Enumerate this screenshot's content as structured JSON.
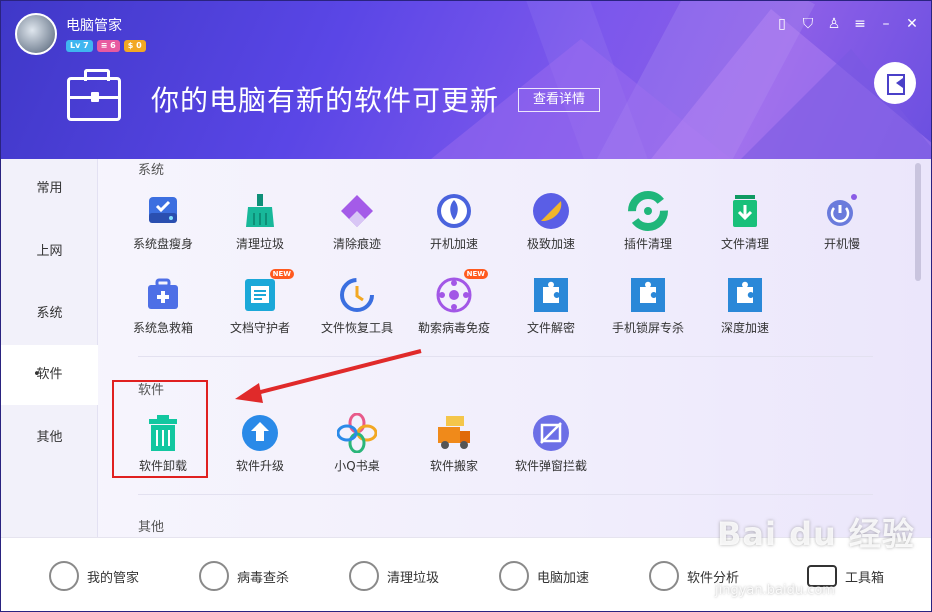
{
  "app": {
    "name": "电脑管家",
    "badges": [
      "Lv 7",
      "≡ 6",
      "$ 0"
    ]
  },
  "window_controls": [
    "phone-icon",
    "shield-icon",
    "shirt-icon",
    "menu-icon",
    "minimize-icon",
    "close-icon"
  ],
  "hero": {
    "title": "你的电脑有新的软件可更新",
    "button": "查看详情"
  },
  "sidebar": {
    "items": [
      {
        "label": "常用"
      },
      {
        "label": "上网"
      },
      {
        "label": "系统"
      },
      {
        "label": "软件",
        "active": true
      },
      {
        "label": "其他"
      }
    ]
  },
  "sections": {
    "system_title": "系统",
    "software_title": "软件",
    "other_title": "其他"
  },
  "system_tools": [
    {
      "label": "系统盘瘦身",
      "icon": "disk-icon",
      "color": "#3c6fe0"
    },
    {
      "label": "清理垃圾",
      "icon": "broom-icon",
      "color": "#18b89a"
    },
    {
      "label": "清除痕迹",
      "icon": "eraser-icon",
      "color": "#a45be8"
    },
    {
      "label": "开机加速",
      "icon": "rocket-icon",
      "color": "#4a63dd"
    },
    {
      "label": "极致加速",
      "icon": "feather-icon",
      "color": "#5a5ee6"
    },
    {
      "label": "插件清理",
      "icon": "puzzle-green-icon",
      "color": "#1fb67a"
    },
    {
      "label": "文件清理",
      "icon": "bin-download-icon",
      "color": "#18c07a"
    },
    {
      "label": "开机慢",
      "icon": "power-icon",
      "color": "#6a7bdc"
    },
    {
      "label": "系统急救箱",
      "icon": "firstaid-icon",
      "color": "#4e6fe6"
    },
    {
      "label": "文档守护者",
      "icon": "document-icon",
      "color": "#1ba8d8",
      "new": "NEW"
    },
    {
      "label": "文件恢复工具",
      "icon": "restore-icon",
      "color": "#3a6fe0"
    },
    {
      "label": "勒索病毒免疫",
      "icon": "virus-icon",
      "color": "#a257e6",
      "new": "NEW"
    },
    {
      "label": "文件解密",
      "icon": "puzzle-blue-icon",
      "color": "#2a88d8"
    },
    {
      "label": "手机锁屏专杀",
      "icon": "puzzle-blue-icon",
      "color": "#2a88d8"
    },
    {
      "label": "深度加速",
      "icon": "puzzle-blue-icon",
      "color": "#2a88d8"
    }
  ],
  "software_tools": [
    {
      "label": "软件卸载",
      "icon": "trash-icon",
      "color": "#12c7a0"
    },
    {
      "label": "软件升级",
      "icon": "upgrade-icon",
      "color": "#2a8ae8"
    },
    {
      "label": "小Q书桌",
      "icon": "clover-icon",
      "color": "#e88a2a"
    },
    {
      "label": "软件搬家",
      "icon": "truck-icon",
      "color": "#f08a1a"
    },
    {
      "label": "软件弹窗拦截",
      "icon": "block-popup-icon",
      "color": "#6c6fe6"
    }
  ],
  "bottom_nav": [
    {
      "label": "我的管家",
      "icon": "butler-icon"
    },
    {
      "label": "病毒查杀",
      "icon": "virus-scan-icon"
    },
    {
      "label": "清理垃圾",
      "icon": "vacuum-icon"
    },
    {
      "label": "电脑加速",
      "icon": "rocket-icon"
    },
    {
      "label": "软件分析",
      "icon": "analysis-icon"
    },
    {
      "label": "工具箱",
      "icon": "toolbox-icon"
    }
  ],
  "watermark": {
    "logo": "Bai du 经验",
    "url": "jingyan.baidu.com"
  }
}
